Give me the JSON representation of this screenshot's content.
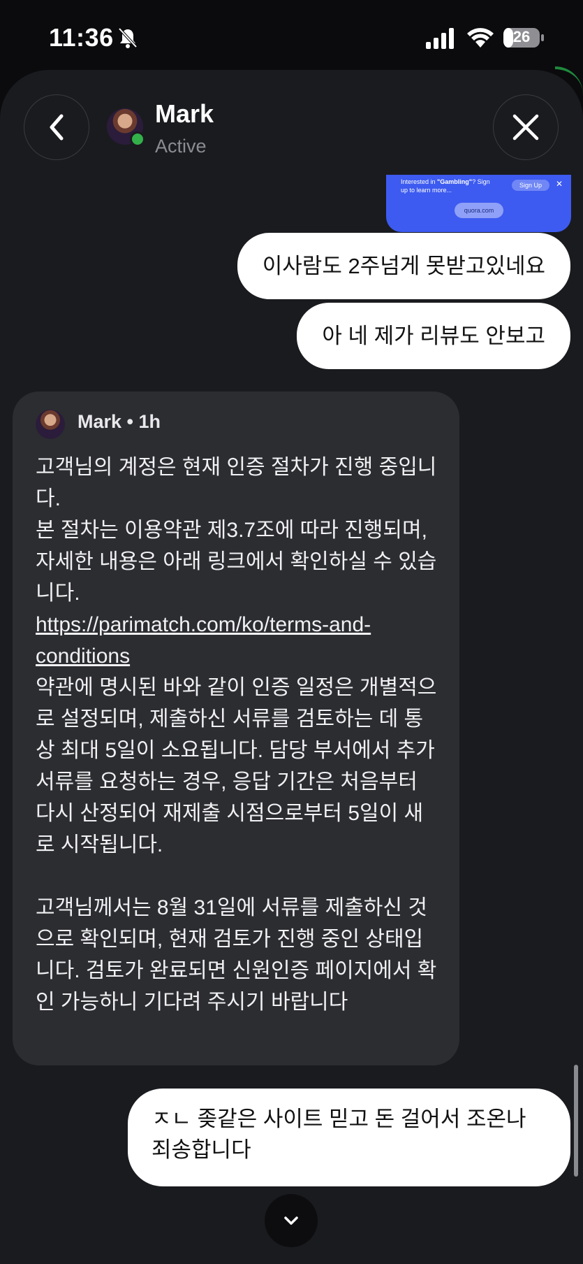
{
  "status_bar": {
    "time": "11:36",
    "battery": "26"
  },
  "header": {
    "name": "Mark",
    "status": "Active"
  },
  "ad": {
    "prefix": "Interested in ",
    "topic": "\"Gambling\"",
    "suffix": "? Sign up to learn more...",
    "signup_label": "Sign Up",
    "close_label": "✕",
    "link_label": "quora.com"
  },
  "messages": {
    "out1": "이사람도 2주넘게 못받고있네요",
    "out2": "아 네 제가 리뷰도 안보고",
    "in_card": {
      "meta": "Mark • 1h",
      "text_before": "고객님의 계정은 현재 인증 절차가 진행 중입니다.\n본 절차는 이용약관 제3.7조에 따라 진행되며, 자세한 내용은 아래 링크에서 확인하실 수 있습니다.\n",
      "link": "https://parimatch.com/ko/terms-and-conditions",
      "text_after": "\n약관에 명시된 바와 같이 인증 일정은 개별적으로 설정되며, 제출하신 서류를 검토하는 데 통상 최대 5일이 소요됩니다. 담당 부서에서 추가 서류를 요청하는 경우, 응답 기간은 처음부터 다시 산정되어 재제출 시점으로부터 5일이 새로 시작됩니다.\n\n고객님께서는 8월 31일에 서류를 제출하신 것으로 확인되며, 현재 검토가 진행 중인 상태입니다. 검토가 완료되면 신원인증 페이지에서 확인 가능하니 기다려 주시기 바랍니다"
    },
    "out3": "ㅈㄴ 좆같은 사이트 믿고 돈 걸어서 조온나 죄송합니다"
  }
}
